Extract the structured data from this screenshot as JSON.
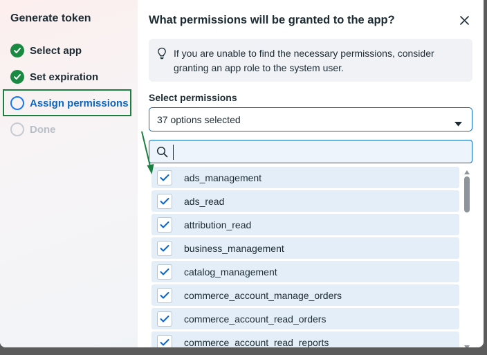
{
  "sidebar": {
    "title": "Generate token",
    "steps": [
      {
        "label": "Select app",
        "state": "done"
      },
      {
        "label": "Set expiration",
        "state": "done"
      },
      {
        "label": "Assign permissions",
        "state": "active"
      },
      {
        "label": "Done",
        "state": "pending"
      }
    ]
  },
  "dialog": {
    "title": "What permissions will be granted to the app?",
    "close_icon": "close-icon",
    "info": {
      "icon": "lightbulb-icon",
      "text": "If you are unable to find the necessary permissions, consider granting an app role to the system user."
    },
    "select_label": "Select permissions",
    "select_value": "37 options selected",
    "search_value": "",
    "options": [
      {
        "label": "ads_management",
        "checked": true
      },
      {
        "label": "ads_read",
        "checked": true
      },
      {
        "label": "attribution_read",
        "checked": true
      },
      {
        "label": "business_management",
        "checked": true
      },
      {
        "label": "catalog_management",
        "checked": true
      },
      {
        "label": "commerce_account_manage_orders",
        "checked": true
      },
      {
        "label": "commerce_account_read_orders",
        "checked": true
      },
      {
        "label": "commerce_account_read_reports",
        "checked": true
      }
    ]
  },
  "colors": {
    "accent": "#0a66c2",
    "done": "#1a8a42",
    "highlight": "#1a7f3f",
    "option_bg": "#e3eef8"
  }
}
